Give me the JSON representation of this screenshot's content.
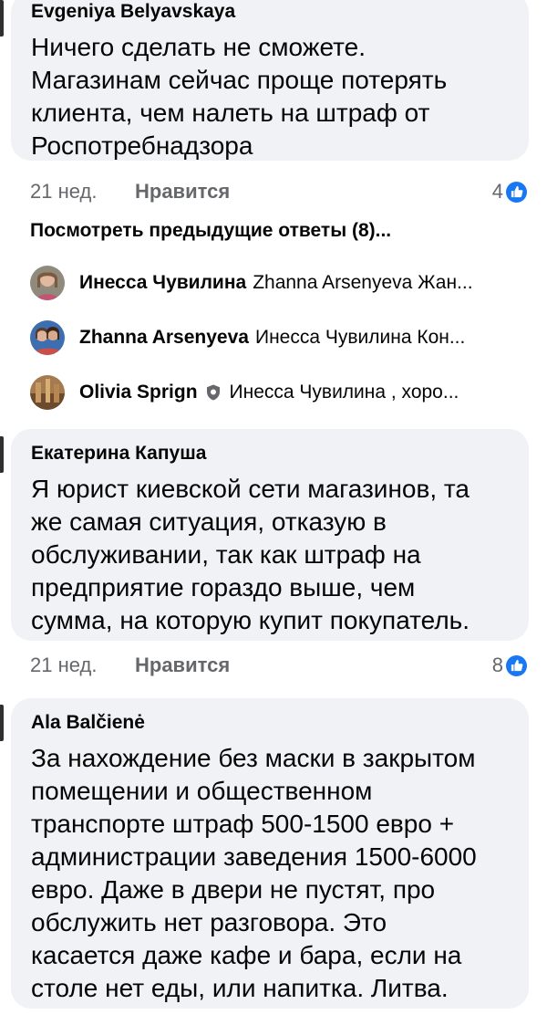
{
  "comments": [
    {
      "author": "Evgeniya Belyavskaya",
      "lines": [
        "Ничего сделать не сможете.",
        "Магазинам сейчас проще потерять",
        "клиента, чем налеть на штраф от",
        "Роспотребнадзора"
      ],
      "time": "21 нед.",
      "like_label": "Нравится",
      "reactions": "4"
    },
    {
      "author": "Екатерина Капуша",
      "lines": [
        "Я юрист киевской сети магазинов, та",
        "же самая ситуация, отказую в",
        "обслуживании, так как штраф на",
        "предприятие гораздо выше, чем",
        "сумма, на которую купит покупатель."
      ],
      "time": "21 нед.",
      "like_label": "Нравится",
      "reactions": "8"
    },
    {
      "author": "Ala Balčienė",
      "lines": [
        "За нахождение без маски в закрытом",
        "помещении и общественном",
        "транспорте штраф 500-1500 евро +",
        "администрации заведения 1500-6000",
        "евро. Даже в двери не пустят, про",
        "обслужить нет разговора. Это",
        "касается даже кафе и бара, если на",
        "столе нет еды, или напитка. Литва."
      ]
    }
  ],
  "previous_replies": "Посмотреть предыдущие ответы (8)...",
  "replies": [
    {
      "name": "Инесса Чувилина",
      "text": "Zhanna Arsenyeva Жан..."
    },
    {
      "name": "Zhanna Arsenyeva",
      "text": "Инесса Чувилина Кон..."
    },
    {
      "name": "Olivia Sprign",
      "text": "Инесса Чувилина , хоро..."
    }
  ],
  "colors": {
    "bubble": "#f0f2f5",
    "meta_text": "#65676b",
    "like_blue": "#1877f2",
    "text": "#050505"
  },
  "icons": {
    "reaction": "like-thumb-icon",
    "badge": "shield-icon"
  }
}
